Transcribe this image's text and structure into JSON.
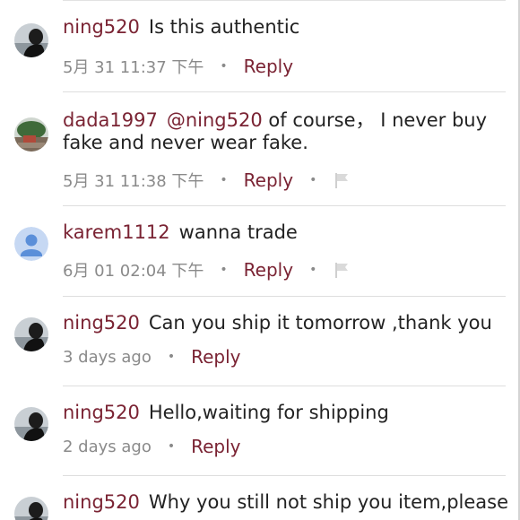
{
  "comments": [
    {
      "user": "ning520",
      "mention": "",
      "text": "Is this authentic",
      "time": "5月 31 11:37 下午",
      "reply_label": "Reply",
      "has_flag": false,
      "avatar": "avatar-silhouette"
    },
    {
      "user": "dada1997",
      "mention": "@ning520",
      "text": "of course，  I never buy fake and never wear fake.",
      "time": "5月 31 11:38 下午",
      "reply_label": "Reply",
      "has_flag": true,
      "avatar": "avatar-landscape"
    },
    {
      "user": "karem1112",
      "mention": "",
      "text": "wanna trade",
      "time": "6月 01 02:04 下午",
      "reply_label": "Reply",
      "has_flag": true,
      "avatar": "default-user-icon"
    },
    {
      "user": "ning520",
      "mention": "",
      "text": "Can you ship  it tomorrow ,thank you",
      "time": "3 days ago",
      "reply_label": "Reply",
      "has_flag": false,
      "avatar": "avatar-silhouette"
    },
    {
      "user": "ning520",
      "mention": "",
      "text": "Hello,waiting for shipping",
      "time": "2 days ago",
      "reply_label": "Reply",
      "has_flag": false,
      "avatar": "avatar-silhouette"
    },
    {
      "user": "ning520",
      "mention": "",
      "text": "Why you still not ship you item,please",
      "time": "",
      "reply_label": "",
      "has_flag": false,
      "avatar": "avatar-silhouette"
    }
  ],
  "colors": {
    "username": "#7a2333",
    "meta_gray": "#8a8a8a",
    "text": "#222222",
    "default_avatar_bg": "#c6d8f3",
    "default_avatar_fg": "#5b8fd9"
  }
}
